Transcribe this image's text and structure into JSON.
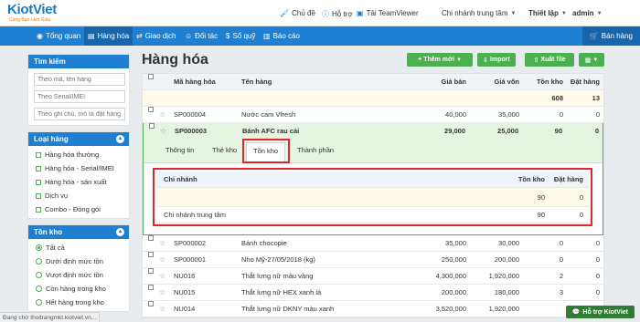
{
  "brand": {
    "name": "KiotViet",
    "tagline": "Cùng Bạn Làm Giàu"
  },
  "topbar": {
    "theme": "Chủ đề",
    "help": "Hỗ trợ",
    "teamviewer": "Tải TeamViewer",
    "branch": "Chi nhánh trung tâm",
    "settings": "Thiết lập",
    "user": "admin"
  },
  "nav": {
    "items": [
      {
        "label": "Tổng quan",
        "icon": "eye-icon"
      },
      {
        "label": "Hàng hóa",
        "icon": "box-icon"
      },
      {
        "label": "Giao dịch",
        "icon": "exchange-icon"
      },
      {
        "label": "Đối tác",
        "icon": "users-icon"
      },
      {
        "label": "Sổ quỹ",
        "icon": "dollar-icon"
      },
      {
        "label": "Báo cáo",
        "icon": "chart-icon"
      }
    ],
    "sale": "Bán hàng"
  },
  "sidebar": {
    "search_title": "Tìm kiếm",
    "search_placeholders": [
      "Theo mã, tên hàng",
      "Theo Serial/IMEI",
      "Theo ghi chú, mô tả đặt hàng"
    ],
    "type_title": "Loại hàng",
    "types": [
      "Hàng hóa thường",
      "Hàng hóa - Serial/IMEI",
      "Hàng hóa - sản xuất",
      "Dịch vụ",
      "Combo - Đóng gói"
    ],
    "stock_title": "Tồn kho",
    "stock_options": [
      "Tất cả",
      "Dưới định mức tồn",
      "Vượt định mức tồn",
      "Còn hàng trong kho",
      "Hết hàng trong kho"
    ]
  },
  "page": {
    "title": "Hàng hóa",
    "add_new": "Thêm mới",
    "import": "Import",
    "export": "Xuất file"
  },
  "table": {
    "headers": {
      "code": "Mã hàng hóa",
      "name": "Tên hàng",
      "price": "Giá bán",
      "cost": "Giá vốn",
      "stock": "Tồn kho",
      "order": "Đặt hàng"
    },
    "summary": {
      "stock": "608",
      "order": "13"
    },
    "rows_before": [
      {
        "code": "SP000004",
        "name": "Nước cam Vfresh",
        "price": "40,000",
        "cost": "35,000",
        "stock": "0",
        "order": "0"
      }
    ],
    "expanded": {
      "code": "SP000003",
      "name": "Bánh AFC rau cải",
      "price": "29,000",
      "cost": "25,000",
      "stock": "90",
      "order": "0",
      "tabs": [
        "Thông tin",
        "Thẻ kho",
        "Tồn kho",
        "Thành phần"
      ],
      "inner": {
        "headers": {
          "branch": "Chi nhánh",
          "stock": "Tồn kho",
          "order": "Đặt hàng"
        },
        "summary": {
          "stock": "90",
          "order": "0"
        },
        "rows": [
          {
            "branch": "Chi nhánh trung tâm",
            "stock": "90",
            "order": "0"
          }
        ]
      }
    },
    "rows_after": [
      {
        "code": "SP000002",
        "name": "Bánh chocopie",
        "price": "35,000",
        "cost": "30,000",
        "stock": "0",
        "order": "0"
      },
      {
        "code": "SP000001",
        "name": "Nho Mỹ-27/05/2018 (kg)",
        "price": "250,000",
        "cost": "200,000",
        "stock": "0",
        "order": "0"
      },
      {
        "code": "NU016",
        "name": "Thắt lưng nữ màu vàng",
        "price": "4,300,000",
        "cost": "1,920,000",
        "stock": "2",
        "order": "0"
      },
      {
        "code": "NU015",
        "name": "Thắt lưng nữ HEX xanh lá",
        "price": "200,000",
        "cost": "180,000",
        "stock": "3",
        "order": "0"
      },
      {
        "code": "NU014",
        "name": "Thắt lưng nữ DKNY màu xanh",
        "price": "3,520,000",
        "cost": "1,920,000",
        "stock": "",
        "order": ""
      }
    ]
  },
  "status_text": "Đang chờ thoitrangmkt.kiotviet.vn...",
  "support": "Hỗ trợ KiotViet"
}
